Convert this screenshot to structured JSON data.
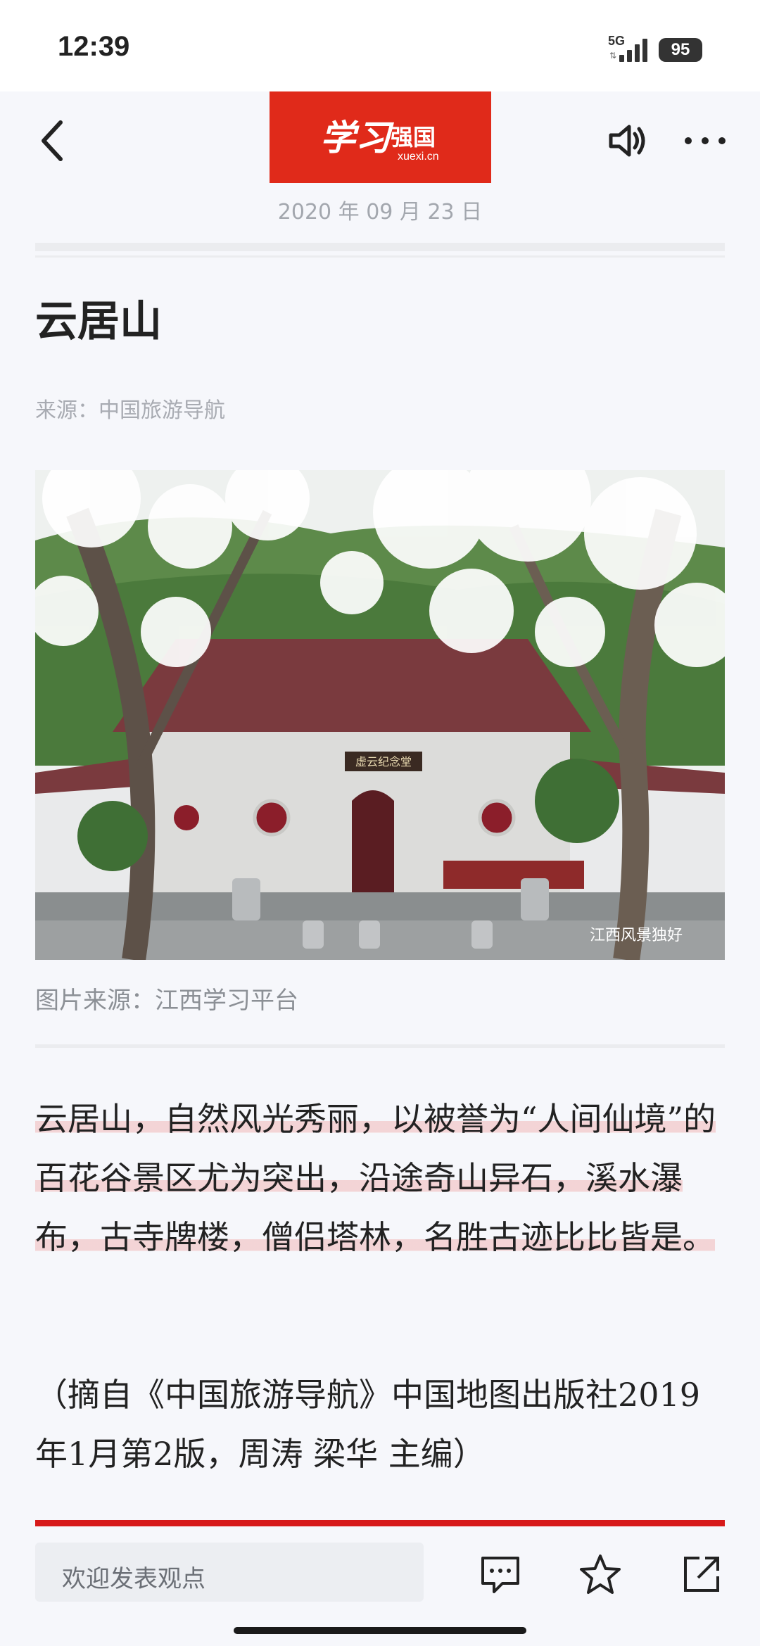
{
  "status_bar": {
    "time": "12:39",
    "network": "5G",
    "battery": "95"
  },
  "header": {
    "logo_calligraphy": "学习",
    "logo_brand": "强国",
    "logo_site": "xuexi.cn",
    "date": "2020 年 09 月 23 日",
    "back_icon": "chevron-left-icon",
    "audio_icon": "speaker-icon",
    "more_icon": "more-dots-icon"
  },
  "article": {
    "title": "云居山",
    "source": "来源：中国旅游导航",
    "image_watermark": "江西风景独好",
    "image_caption": "图片来源：江西学习平台",
    "plaque_text": "虚云纪念堂",
    "paragraph1": "云居山，自然风光秀丽，以被誉为“人间仙境”的百花谷景区尤为突出，沿途奇山异石，溪水瀑布，古寺牌楼，僧侣塔林，名胜古迹比比皆是。",
    "paragraph2": "（摘自《中国旅游导航》中国地图出版社2019年1月第2版，周涛 梁华 主编）"
  },
  "bottom_bar": {
    "comment_placeholder": "欢迎发表观点",
    "comment_icon": "comment-icon",
    "favorite_icon": "star-icon",
    "share_icon": "share-icon"
  },
  "colors": {
    "brand_red": "#e02a1a",
    "accent_red": "#d71a1a",
    "highlight": "#f0aaaa",
    "background": "#f6f7fb"
  }
}
